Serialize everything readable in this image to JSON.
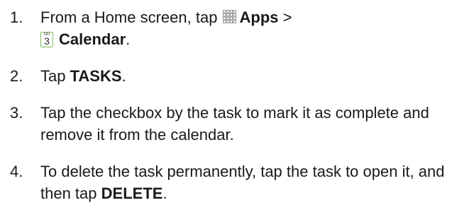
{
  "steps": [
    {
      "number": "1.",
      "line1_prefix": "From a Home screen, tap ",
      "apps_icon": "apps-grid-icon",
      "apps_label": "Apps",
      "line1_sep": " >",
      "calendar_icon": "calendar-icon",
      "calendar_icon_dayname": "FRI",
      "calendar_icon_daynum": "3",
      "calendar_label": "Calendar",
      "line2_suffix": "."
    },
    {
      "number": "2.",
      "prefix": "Tap ",
      "bold": "TASKS",
      "suffix": "."
    },
    {
      "number": "3.",
      "text": "Tap the checkbox by the task to mark it as complete and remove it from the calendar."
    },
    {
      "number": "4.",
      "prefix": "To delete the task permanently, tap the task to open it, and then tap ",
      "bold": "DELETE",
      "suffix": "."
    }
  ]
}
